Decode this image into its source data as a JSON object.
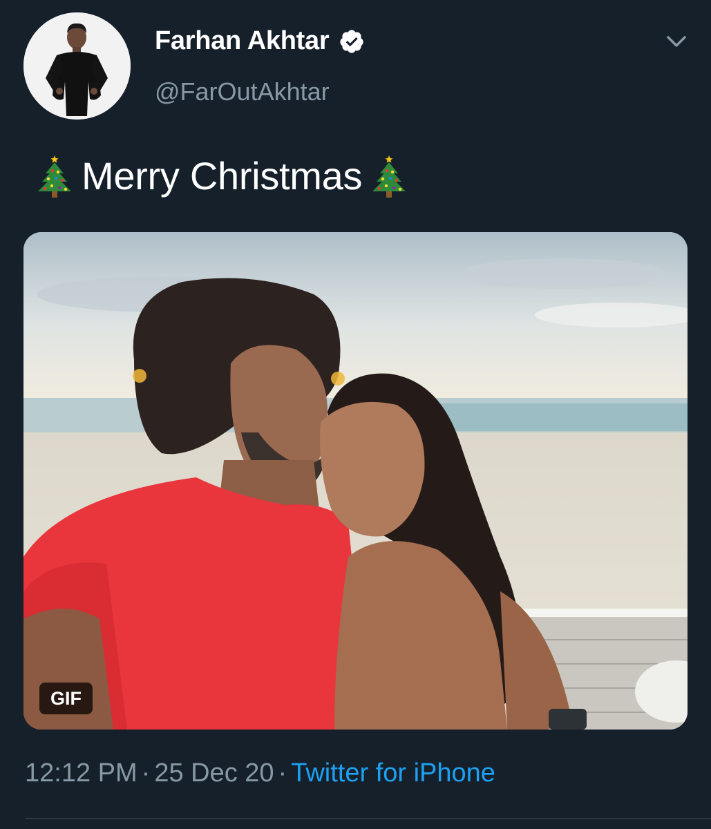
{
  "author": {
    "display_name": "Farhan Akhtar",
    "handle": "@FarOutAkhtar",
    "verified": true,
    "avatar_icon": "person-portrait-avatar",
    "verified_icon": "verified-badge-icon"
  },
  "menu_icon": "chevron-down-icon",
  "tweet": {
    "leading_emoji": "christmas-tree-emoji",
    "text": "Merry Christmas",
    "trailing_emoji": "christmas-tree-emoji"
  },
  "media": {
    "type": "gif",
    "badge_label": "GIF"
  },
  "meta": {
    "time": "12:12 PM",
    "separator": "·",
    "date": "25 Dec 20",
    "source": "Twitter for iPhone"
  },
  "colors": {
    "background": "#15202b",
    "text": "#ffffff",
    "secondary": "#8899a6",
    "link": "#1da1f2",
    "divider": "#38444d"
  }
}
